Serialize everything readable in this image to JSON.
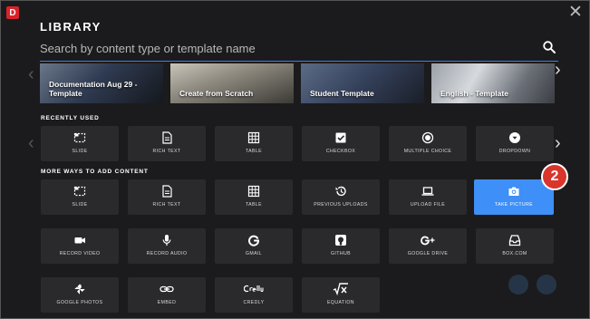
{
  "header": {
    "logo_letter": "D",
    "title": "LIBRARY",
    "close_icon": "close-icon"
  },
  "search": {
    "placeholder": "Search by content type or template name",
    "value": ""
  },
  "templates": [
    {
      "label": "Documentation Aug 29 - Template"
    },
    {
      "label": "Create from Scratch"
    },
    {
      "label": "Student Template"
    },
    {
      "label": "English - Template"
    }
  ],
  "recently_used": {
    "heading": "RECENTLY USED",
    "items": [
      {
        "label": "Slide",
        "icon": "slide-icon"
      },
      {
        "label": "Rich Text",
        "icon": "document-icon"
      },
      {
        "label": "Table",
        "icon": "table-icon"
      },
      {
        "label": "Checkbox",
        "icon": "checkbox-icon"
      },
      {
        "label": "Multiple Choice",
        "icon": "radio-icon"
      },
      {
        "label": "Dropdown",
        "icon": "dropdown-icon"
      }
    ]
  },
  "more_ways": {
    "heading": "MORE WAYS TO ADD CONTENT",
    "items": [
      {
        "label": "Slide",
        "icon": "slide-icon"
      },
      {
        "label": "Rich Text",
        "icon": "document-icon"
      },
      {
        "label": "Table",
        "icon": "table-icon"
      },
      {
        "label": "Previous Uploads",
        "icon": "history-icon"
      },
      {
        "label": "Upload File",
        "icon": "laptop-icon"
      },
      {
        "label": "Take Picture",
        "icon": "camera-icon",
        "active": true
      },
      {
        "label": "Record Video",
        "icon": "videocam-icon"
      },
      {
        "label": "Record Audio",
        "icon": "microphone-icon"
      },
      {
        "label": "Gmail",
        "icon": "google-icon"
      },
      {
        "label": "Github",
        "icon": "github-icon"
      },
      {
        "label": "Google Drive",
        "icon": "google-plus-icon"
      },
      {
        "label": "Box.com",
        "icon": "inbox-icon"
      },
      {
        "label": "Google Photos",
        "icon": "pinwheel-icon"
      },
      {
        "label": "Embed",
        "icon": "link-icon"
      },
      {
        "label": "Credly",
        "icon": "credly-icon"
      },
      {
        "label": "Equation",
        "icon": "sqrt-icon"
      }
    ]
  },
  "step_badge": "2",
  "colors": {
    "accent": "#3e8ff7",
    "badge": "#d9352b",
    "brand": "#d8222a",
    "tile": "#2a2a2c",
    "background": "#1b1b1d"
  }
}
